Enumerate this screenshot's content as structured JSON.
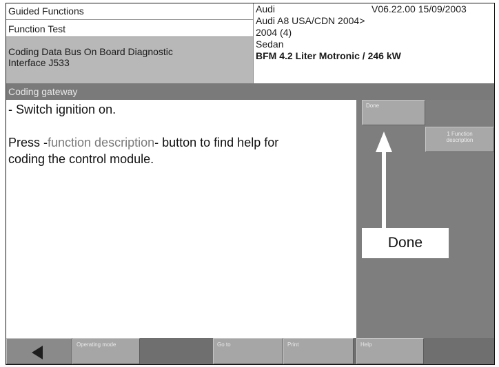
{
  "header": {
    "left": {
      "row1": "Guided Functions",
      "row2": "Function Test",
      "row3_line1": "Coding Data Bus On Board Diagnostic",
      "row3_line2": "Interface J533"
    },
    "right": {
      "brand": "Audi",
      "version": "V06.22.00 15/09/2003",
      "model": "Audi A8 USA/CDN 2004>",
      "year": "2004 (4)",
      "body": "Sedan",
      "engine": "BFM 4.2 Liter Motronic / 246 kW"
    }
  },
  "title": "Coding gateway",
  "message": {
    "line1": "- Switch ignition on.",
    "line2_pre": "Press -",
    "line2_hl": "function description",
    "line2_post": "- button to find help for",
    "line3": "coding the control module."
  },
  "side_buttons": {
    "done": "Done",
    "function_desc_1": "1 Function",
    "function_desc_2": "description"
  },
  "annotation": {
    "label": "Done"
  },
  "toolbar": {
    "operating_mode": "Operating mode",
    "goto": "Go to",
    "print": "Print",
    "help": "Help"
  },
  "colors": {
    "panel_gray": "#7e7e7e",
    "button_gray": "#a8a8a8",
    "highlight_row": "#b8b8b8"
  }
}
